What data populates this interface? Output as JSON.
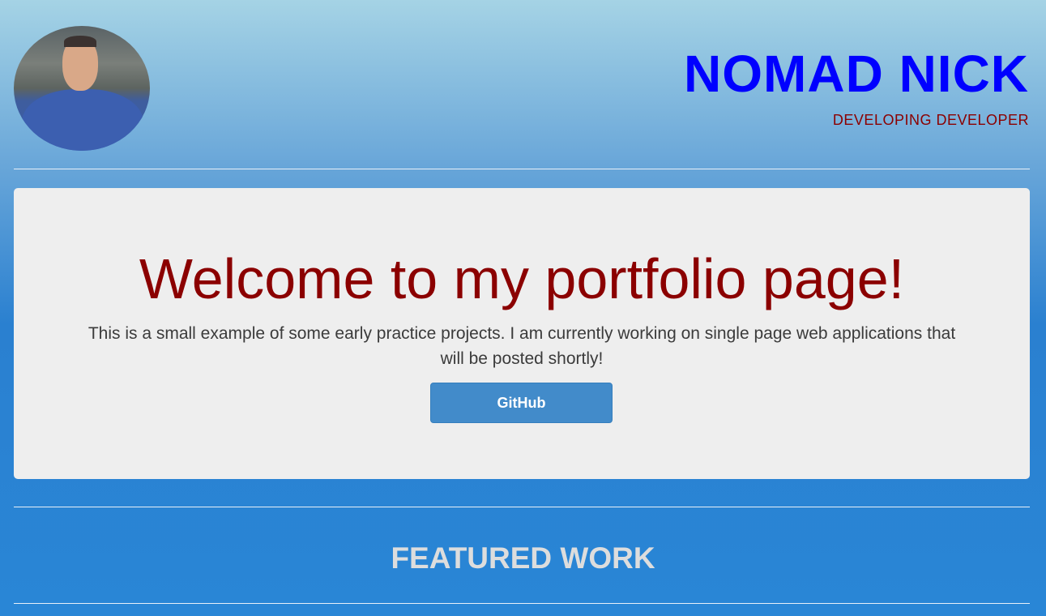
{
  "header": {
    "name": "NOMAD NICK",
    "tagline": "DEVELOPING DEVELOPER"
  },
  "jumbotron": {
    "heading": "Welcome to my portfolio page!",
    "text": "This is a small example of some early practice projects. I am currently working on single page web applications that will be posted shortly!",
    "button_label": "GitHub"
  },
  "sections": {
    "featured_title": "FEATURED WORK"
  }
}
